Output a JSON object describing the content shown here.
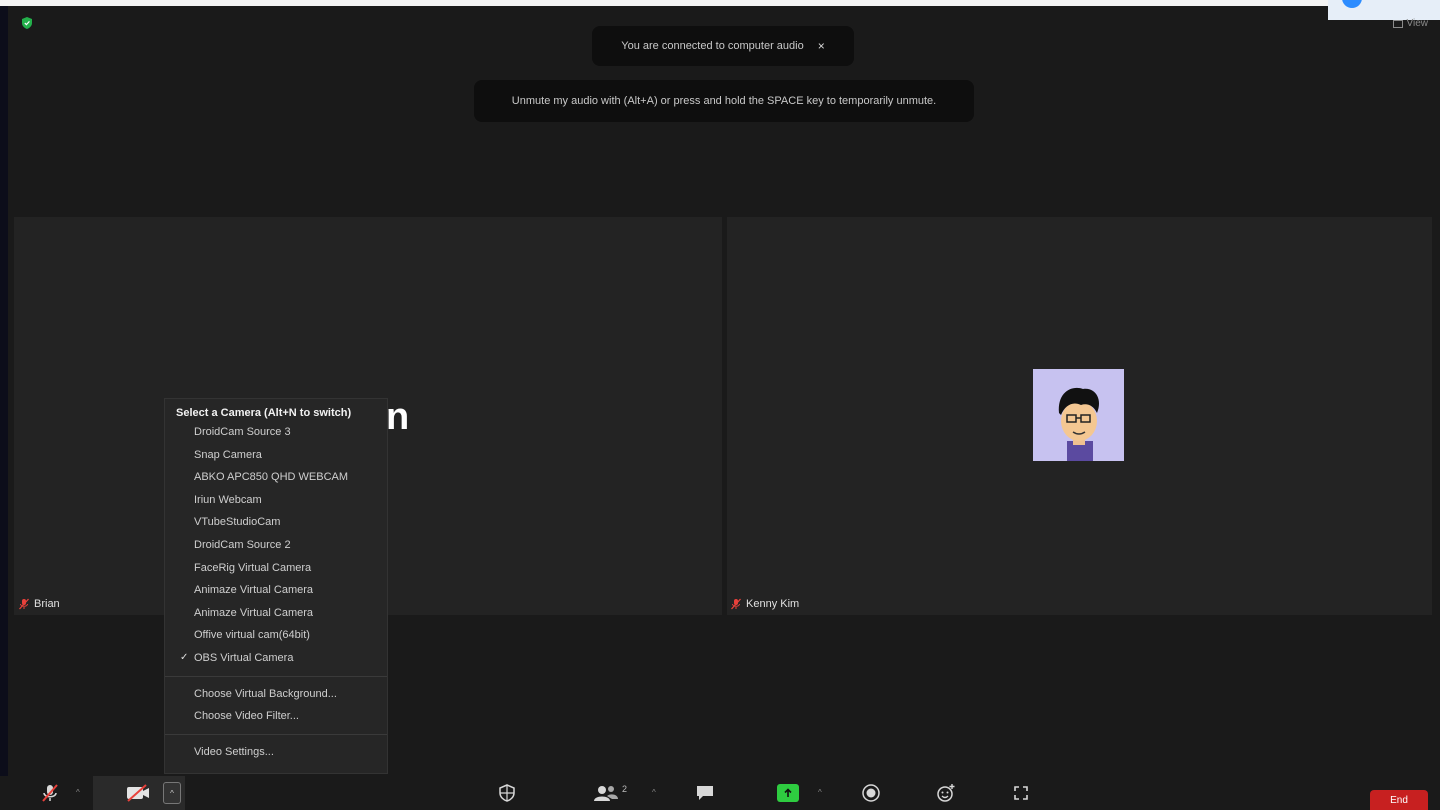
{
  "notifications": {
    "audio_connected": "You are connected to computer audio",
    "close_glyph": "×",
    "unmute_hint": "Unmute my audio with (Alt+A) or press and hold the SPACE key to temporarily unmute."
  },
  "top_right": {
    "view_label": "View",
    "view_icon": "grid-icon"
  },
  "participants": {
    "left": {
      "name": "Brian",
      "display_text": "n",
      "mic_icon": "mic-muted-icon"
    },
    "right": {
      "name": "Kenny Kim",
      "mic_icon": "mic-muted-icon"
    }
  },
  "camera_menu": {
    "header": "Select a Camera (Alt+N to switch)",
    "cameras": [
      "DroidCam Source 3",
      "Snap Camera",
      "ABKO APC850 QHD WEBCAM",
      "Iriun Webcam",
      "VTubeStudioCam",
      "DroidCam Source 2",
      "FaceRig Virtual Camera",
      "Animaze Virtual Camera",
      "Animaze Virtual Camera",
      "Offive virtual cam(64bit)",
      "OBS Virtual Camera"
    ],
    "selected_index": 10,
    "check_glyph": "✓",
    "extra_items": [
      "Choose Virtual Background...",
      "Choose Video Filter..."
    ],
    "settings_item": "Video Settings..."
  },
  "toolbar": {
    "caret_glyph": "^",
    "participants_count": "2",
    "end_label": "End",
    "icons": [
      "mic-muted-icon",
      "video-icon",
      "security-icon",
      "participants-icon",
      "chat-icon",
      "share-screen-icon",
      "record-icon",
      "reactions-icon",
      "apps-icon"
    ]
  },
  "colors": {
    "share_green": "#2ecc40",
    "end_red": "#c72020",
    "avatar_bg": "#c7c2f0",
    "mute_red": "#e8413b"
  }
}
